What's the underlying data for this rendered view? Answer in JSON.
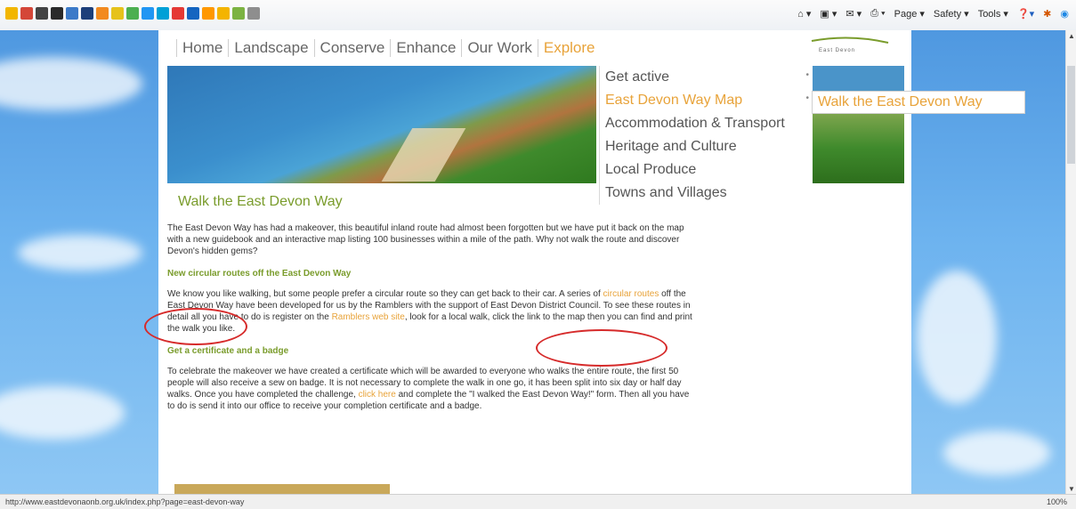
{
  "browser": {
    "command_bar": {
      "page": "Page ▾",
      "safety": "Safety ▾",
      "tools": "Tools ▾"
    },
    "status_url": "http://www.eastdevonaonb.org.uk/index.php?page=east-devon-way",
    "zoom": "100%"
  },
  "site": {
    "nav": [
      "Home",
      "Landscape",
      "Conserve",
      "Enhance",
      "Our Work",
      "Explore"
    ],
    "active_nav": "Explore",
    "logo": "East Devon",
    "menu": {
      "items": [
        "Get active",
        "East Devon Way Map",
        "Accommodation & Transport",
        "Heritage and Culture",
        "Local Produce",
        "Towns and Villages"
      ],
      "submenu_item": "Walk the East Devon Way"
    },
    "page_title": "Walk the East Devon Way",
    "intro": "The East Devon Way has had a makeover, this beautiful inland route had almost been forgotten but we have put it back on the map with a new guidebook and an interactive map listing 100 businesses within a mile of the path. Why not walk the route and discover Devon's hidden gems?",
    "section1": {
      "heading": "New circular routes off the East Devon Way",
      "text_a": "We know you like walking, but some people prefer a circular route so they can get back to their car. A series of ",
      "link_a": "circular routes",
      "text_b": " off the East Devon Way have been developed for us by the Ramblers with the support of East Devon District Council. To see these routes in detail all you have to do is register on the ",
      "link_b": "Ramblers web site",
      "text_c": ", look for a local walk, click the link to the map then you can find and print the walk you like."
    },
    "section2": {
      "heading": "Get a certificate and a badge",
      "text_a": "To celebrate the makeover we have created a certificate which will be awarded to everyone who walks the entire route, the first 50 people will also receive a sew on badge. It is not necessary to complete the walk in one go, it has been split into six day or half day walks. Once you have completed the challenge, ",
      "link": "click here",
      "text_b": " and complete the \"I walked the East Devon Way!\" form. Then all you have to do is send it into our office to receive your completion certificate and a badge."
    }
  },
  "colors": {
    "accent": "#e8a33a",
    "heading_green": "#7a9c2c",
    "annotation_red": "#d62b2b"
  }
}
